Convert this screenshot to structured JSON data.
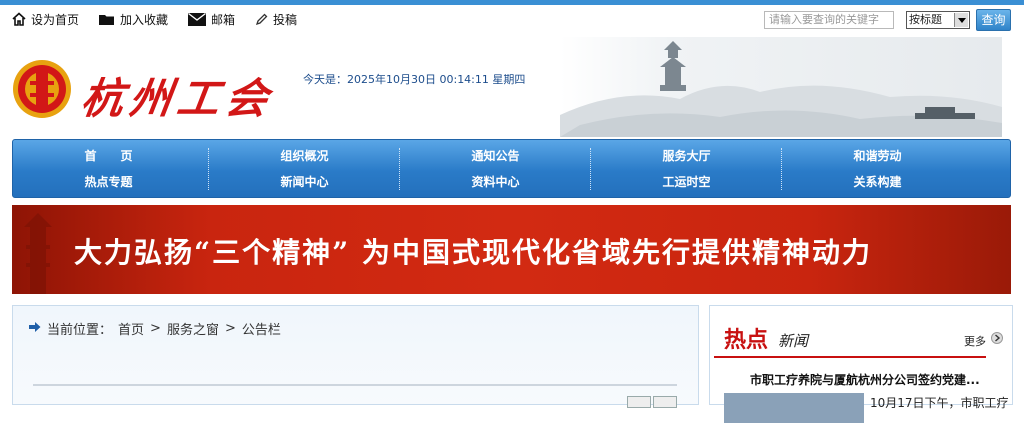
{
  "utility": {
    "items": [
      {
        "label": "设为首页",
        "icon": "home-icon"
      },
      {
        "label": "加入收藏",
        "icon": "folder-icon"
      },
      {
        "label": "邮箱",
        "icon": "mail-icon"
      },
      {
        "label": "投稿",
        "icon": "pen-icon"
      }
    ]
  },
  "search": {
    "placeholder": "请输入要查询的关键字",
    "select_value": "按标题",
    "button_label": "查询"
  },
  "header": {
    "logo_text": "杭州工会",
    "date_label": "今天是：",
    "date_value": "2025年10月30日 00:14:11 星期四"
  },
  "nav": {
    "columns": [
      {
        "top": "首　　页",
        "bottom": "热点专题"
      },
      {
        "top": "组织概况",
        "bottom": "新闻中心"
      },
      {
        "top": "通知公告",
        "bottom": "资料中心"
      },
      {
        "top": "服务大厅",
        "bottom": "工运时空"
      },
      {
        "top": "和谐劳动",
        "bottom": "关系构建"
      }
    ]
  },
  "banner": {
    "slogan": "大力弘扬“三个精神” 为中国式现代化省域先行提供精神动力"
  },
  "breadcrumb": {
    "prefix": "当前位置：",
    "items": [
      "首页",
      "服务之窗",
      "公告栏"
    ],
    "separator": ">"
  },
  "hot_news": {
    "title": "热点",
    "subtitle": "新闻",
    "more_label": "更多",
    "headline": "市职工疗养院与厦航杭州分公司签约党建...",
    "snippet": "10月17日下午，市职工疗"
  },
  "colors": {
    "accent_blue": "#2a7bc8",
    "banner_red": "#c9250f",
    "hot_red": "#c81010"
  }
}
